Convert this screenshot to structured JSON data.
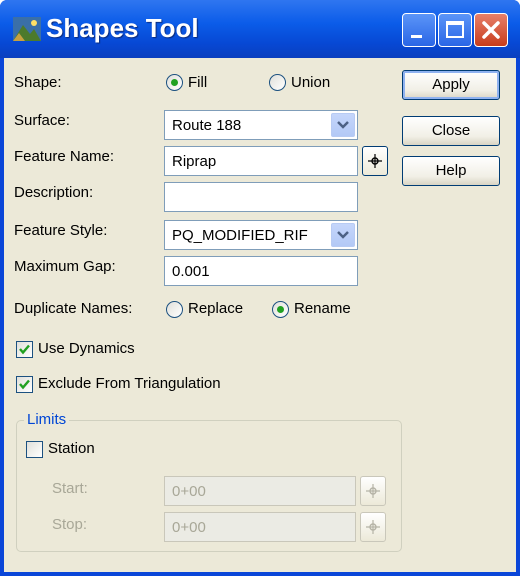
{
  "window": {
    "title": "Shapes Tool"
  },
  "icons": {
    "app": "shapes-tool-app-icon",
    "minimize": "minimize-icon",
    "maximize": "maximize-icon",
    "close": "close-icon",
    "combo_arrow": "chevron-down-icon",
    "pick": "crosshair-icon",
    "check": "checkmark-icon"
  },
  "colors": {
    "title_bar": "#0b5ce9",
    "client": "#ece9d8",
    "group_title": "#0046d5",
    "radio_dot": "#21a121",
    "close_button": "#c73c1c"
  },
  "form": {
    "shape": {
      "label": "Shape:",
      "options": [
        "Fill",
        "Union"
      ],
      "selected": "Fill"
    },
    "surface": {
      "label": "Surface:",
      "value": "Route 188"
    },
    "feature_name": {
      "label": "Feature Name:",
      "value": "Riprap"
    },
    "description": {
      "label": "Description:",
      "value": ""
    },
    "feature_style": {
      "label": "Feature Style:",
      "value": "PQ_MODIFIED_RIF"
    },
    "maximum_gap": {
      "label": "Maximum Gap:",
      "value": "0.001"
    },
    "duplicate_names": {
      "label": "Duplicate Names:",
      "options": [
        "Replace",
        "Rename"
      ],
      "selected": "Rename"
    },
    "use_dynamics": {
      "label": "Use Dynamics",
      "checked": true
    },
    "exclude_triangulation": {
      "label": "Exclude From Triangulation",
      "checked": true
    }
  },
  "limits": {
    "title": "Limits",
    "station": {
      "label": "Station",
      "checked": false
    },
    "start": {
      "label": "Start:",
      "value": "0+00"
    },
    "stop": {
      "label": "Stop:",
      "value": "0+00"
    }
  },
  "buttons": {
    "apply": "Apply",
    "close": "Close",
    "help": "Help"
  }
}
